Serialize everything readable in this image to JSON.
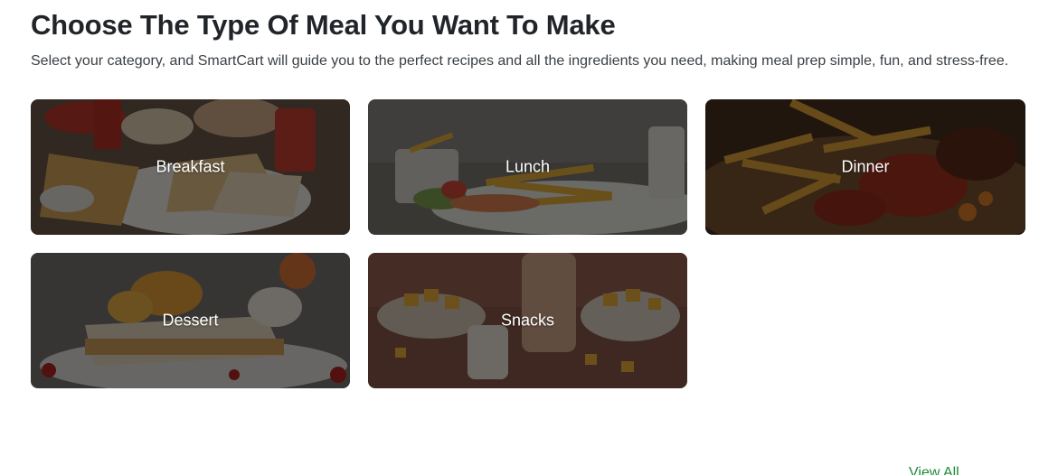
{
  "section": {
    "title": "Choose The Type Of Meal You Want To Make",
    "subtitle": "Select your category, and SmartCart will guide you to the perfect recipes and all the ingredients you need, making meal prep simple, fun, and stress-free."
  },
  "categories": [
    {
      "label": "Breakfast"
    },
    {
      "label": "Lunch"
    },
    {
      "label": "Dinner"
    },
    {
      "label": "Dessert"
    },
    {
      "label": "Snacks"
    }
  ],
  "view_all_label": "View All",
  "colors": {
    "link": "#1f8a3a",
    "overlay": "rgba(0,0,0,0.55)"
  }
}
